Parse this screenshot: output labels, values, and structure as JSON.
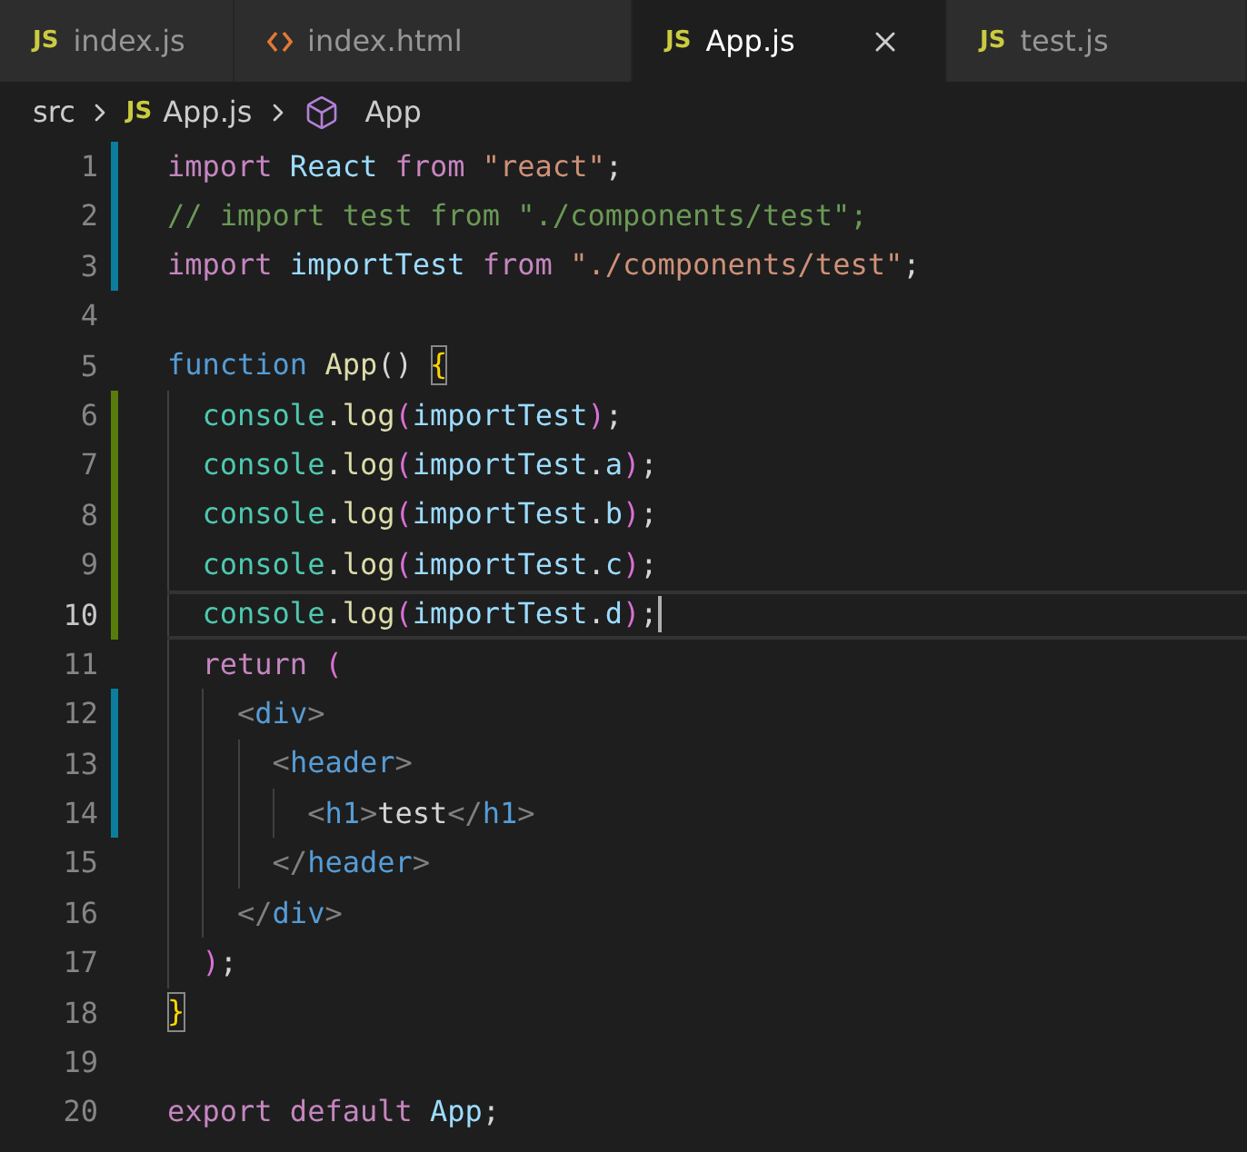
{
  "tabs": [
    {
      "label": "index.js",
      "kind": "js",
      "badge": "JS",
      "selected": false
    },
    {
      "label": "index.html",
      "kind": "html",
      "selected": false
    },
    {
      "label": "App.js",
      "kind": "js",
      "badge": "JS",
      "selected": true
    },
    {
      "label": "test.js",
      "kind": "js",
      "badge": "JS",
      "selected": false
    }
  ],
  "breadcrumb": [
    {
      "label": "src",
      "kind": "folder"
    },
    {
      "label": "App.js",
      "kind": "js",
      "badge": "JS"
    },
    {
      "label": "App",
      "kind": "symbol"
    }
  ],
  "lines": [
    {
      "number": "1",
      "added": false,
      "modified": true,
      "current": false,
      "tokens": [
        {
          "text": "import",
          "kind": "kw"
        },
        {
          "text": " React",
          "kind": "var"
        },
        {
          "text": " from",
          "kind": "kw"
        },
        {
          "text": " \"react\"",
          "kind": "str"
        },
        {
          "text": ";",
          "kind": "punc"
        }
      ]
    },
    {
      "number": "2",
      "added": false,
      "modified": true,
      "current": false,
      "tokens": [
        {
          "text": "// import test from \"./components/test\";",
          "kind": "cmt"
        }
      ]
    },
    {
      "number": "3",
      "added": false,
      "modified": true,
      "current": false,
      "tokens": [
        {
          "text": "import",
          "kind": "kw"
        },
        {
          "text": " importTest",
          "kind": "var"
        },
        {
          "text": " from",
          "kind": "kw"
        },
        {
          "text": " \"./components/test\"",
          "kind": "str"
        },
        {
          "text": ";",
          "kind": "punc"
        }
      ]
    },
    {
      "number": "4",
      "added": false,
      "modified": false,
      "current": false
    },
    {
      "number": "5",
      "added": false,
      "modified": false,
      "current": false,
      "tokens": [
        {
          "text": "function",
          "kind": "decl"
        },
        {
          "text": " App",
          "kind": "fn"
        },
        {
          "text": "() ",
          "kind": "punc"
        },
        {
          "text": "{",
          "kind": "bracket",
          "matched": true
        }
      ]
    },
    {
      "number": "6",
      "added": true,
      "modified": false,
      "current": false,
      "tokens": [
        {
          "text": "  console",
          "kind": "cls"
        },
        {
          "text": ".",
          "kind": "punc"
        },
        {
          "text": "log",
          "kind": "fn"
        },
        {
          "text": "(",
          "kind": "bracket2"
        },
        {
          "text": "importTest",
          "kind": "var"
        },
        {
          "text": ")",
          "kind": "bracket2"
        },
        {
          "text": ";",
          "kind": "punc"
        }
      ]
    },
    {
      "number": "7",
      "added": true,
      "modified": false,
      "current": false,
      "tokens": [
        {
          "text": "  console",
          "kind": "cls"
        },
        {
          "text": ".",
          "kind": "punc"
        },
        {
          "text": "log",
          "kind": "fn"
        },
        {
          "text": "(",
          "kind": "bracket2"
        },
        {
          "text": "importTest",
          "kind": "var"
        },
        {
          "text": ".",
          "kind": "punc"
        },
        {
          "text": "a",
          "kind": "var"
        },
        {
          "text": ")",
          "kind": "bracket2"
        },
        {
          "text": ";",
          "kind": "punc"
        }
      ]
    },
    {
      "number": "8",
      "added": true,
      "modified": false,
      "current": false,
      "tokens": [
        {
          "text": "  console",
          "kind": "cls"
        },
        {
          "text": ".",
          "kind": "punc"
        },
        {
          "text": "log",
          "kind": "fn"
        },
        {
          "text": "(",
          "kind": "bracket2"
        },
        {
          "text": "importTest",
          "kind": "var"
        },
        {
          "text": ".",
          "kind": "punc"
        },
        {
          "text": "b",
          "kind": "var"
        },
        {
          "text": ")",
          "kind": "bracket2"
        },
        {
          "text": ";",
          "kind": "punc"
        }
      ]
    },
    {
      "number": "9",
      "added": true,
      "modified": false,
      "current": false,
      "tokens": [
        {
          "text": "  console",
          "kind": "cls"
        },
        {
          "text": ".",
          "kind": "punc"
        },
        {
          "text": "log",
          "kind": "fn"
        },
        {
          "text": "(",
          "kind": "bracket2"
        },
        {
          "text": "importTest",
          "kind": "var"
        },
        {
          "text": ".",
          "kind": "punc"
        },
        {
          "text": "c",
          "kind": "var"
        },
        {
          "text": ")",
          "kind": "bracket2"
        },
        {
          "text": ";",
          "kind": "punc"
        }
      ]
    },
    {
      "number": "10",
      "added": true,
      "modified": false,
      "current": true,
      "tokens": [
        {
          "text": "  console",
          "kind": "cls"
        },
        {
          "text": ".",
          "kind": "punc"
        },
        {
          "text": "log",
          "kind": "fn"
        },
        {
          "text": "(",
          "kind": "bracket2"
        },
        {
          "text": "importTest",
          "kind": "var"
        },
        {
          "text": ".",
          "kind": "punc"
        },
        {
          "text": "d",
          "kind": "var"
        },
        {
          "text": ")",
          "kind": "bracket2"
        },
        {
          "text": ";",
          "kind": "punc"
        }
      ]
    },
    {
      "number": "11",
      "added": false,
      "modified": false,
      "current": false,
      "tokens": [
        {
          "text": "  return",
          "kind": "kw"
        },
        {
          "text": " (",
          "kind": "bracket2"
        }
      ]
    },
    {
      "number": "12",
      "added": false,
      "modified": true,
      "current": false,
      "tokens": [
        {
          "text": "    <",
          "kind": "tagp"
        },
        {
          "text": "div",
          "kind": "tag"
        },
        {
          "text": ">",
          "kind": "tagp"
        }
      ]
    },
    {
      "number": "13",
      "added": false,
      "modified": true,
      "current": false,
      "tokens": [
        {
          "text": "      <",
          "kind": "tagp"
        },
        {
          "text": "header",
          "kind": "tag"
        },
        {
          "text": ">",
          "kind": "tagp"
        }
      ]
    },
    {
      "number": "14",
      "added": false,
      "modified": true,
      "current": false,
      "tokens": [
        {
          "text": "        <",
          "kind": "tagp"
        },
        {
          "text": "h1",
          "kind": "tag"
        },
        {
          "text": ">",
          "kind": "tagp"
        },
        {
          "text": "test",
          "kind": "text"
        },
        {
          "text": "</",
          "kind": "tagp"
        },
        {
          "text": "h1",
          "kind": "tag"
        },
        {
          "text": ">",
          "kind": "tagp"
        }
      ]
    },
    {
      "number": "15",
      "added": false,
      "modified": false,
      "current": false,
      "tokens": [
        {
          "text": "      </",
          "kind": "tagp"
        },
        {
          "text": "header",
          "kind": "tag"
        },
        {
          "text": ">",
          "kind": "tagp"
        }
      ]
    },
    {
      "number": "16",
      "added": false,
      "modified": false,
      "current": false,
      "tokens": [
        {
          "text": "    </",
          "kind": "tagp"
        },
        {
          "text": "div",
          "kind": "tag"
        },
        {
          "text": ">",
          "kind": "tagp"
        }
      ]
    },
    {
      "number": "17",
      "added": false,
      "modified": false,
      "current": false,
      "tokens": [
        {
          "text": "  )",
          "kind": "bracket2"
        },
        {
          "text": ";",
          "kind": "punc"
        }
      ]
    },
    {
      "number": "18",
      "added": false,
      "modified": false,
      "current": false,
      "tokens": [
        {
          "text": "}",
          "kind": "bracket",
          "matched": true
        }
      ]
    },
    {
      "number": "19",
      "added": false,
      "modified": false,
      "current": false
    },
    {
      "number": "20",
      "added": false,
      "modified": false,
      "current": false,
      "tokens": [
        {
          "text": "export",
          "kind": "kw"
        },
        {
          "text": " default",
          "kind": "kw"
        },
        {
          "text": " App",
          "kind": "var"
        },
        {
          "text": ";",
          "kind": "punc"
        }
      ]
    }
  ]
}
